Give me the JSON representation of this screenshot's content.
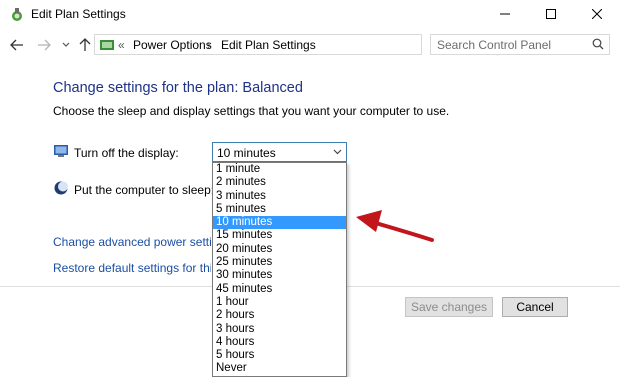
{
  "window": {
    "title": "Edit Plan Settings"
  },
  "address": {
    "breadcrumb_1": "Power Options",
    "breadcrumb_2": "Edit Plan Settings",
    "prefix": "«"
  },
  "search": {
    "placeholder": "Search Control Panel"
  },
  "content": {
    "heading": "Change settings for the plan: Balanced",
    "subtext": "Choose the sleep and display settings that you want your computer to use.",
    "display_label": "Turn off the display:",
    "sleep_label": "Put the computer to sleep:",
    "display_value": "10 minutes",
    "link_advanced": "Change advanced power settings",
    "link_restore": "Restore default settings for this plan"
  },
  "dropdown": {
    "options": [
      "1 minute",
      "2 minutes",
      "3 minutes",
      "5 minutes",
      "10 minutes",
      "15 minutes",
      "20 minutes",
      "25 minutes",
      "30 minutes",
      "45 minutes",
      "1 hour",
      "2 hours",
      "3 hours",
      "4 hours",
      "5 hours",
      "Never"
    ],
    "selected": "10 minutes"
  },
  "buttons": {
    "save": "Save changes",
    "cancel": "Cancel"
  },
  "colors": {
    "heading": "#1e3287",
    "link": "#1a4fa5",
    "selection": "#3399ff",
    "annotation_arrow": "#c0161c"
  }
}
